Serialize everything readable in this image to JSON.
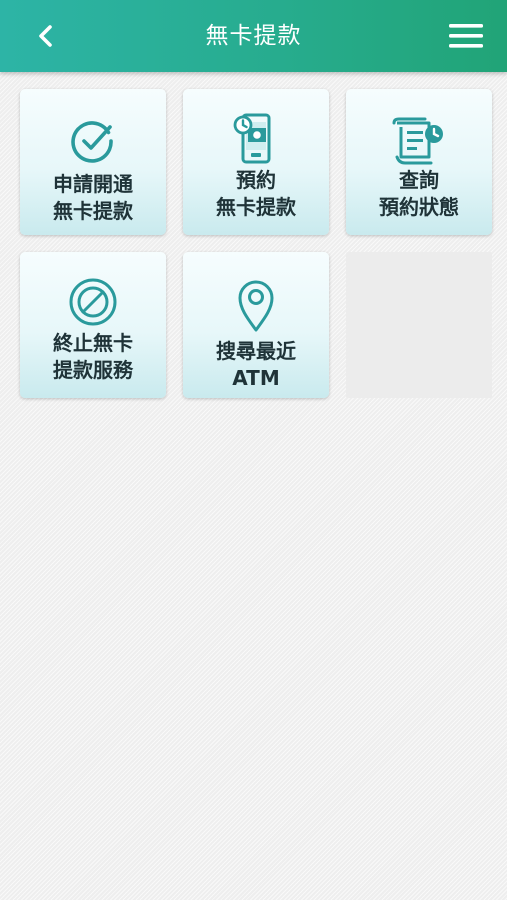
{
  "header": {
    "title": "無卡提款",
    "back_icon": "chevron-left-icon",
    "menu_icon": "hamburger-menu-icon"
  },
  "colors": {
    "header_start": "#2db4a6",
    "header_end": "#21a477",
    "icon_teal": "#2a9a9c",
    "label_text": "#1f3338"
  },
  "tiles": [
    {
      "line1": "申請開通",
      "line2": "無卡提款",
      "icon": "check-circle-icon"
    },
    {
      "line1": "預約",
      "line2": "無卡提款",
      "icon": "phone-cash-clock-icon"
    },
    {
      "line1": "查詢",
      "line2": "預約狀態",
      "icon": "receipt-clock-icon"
    },
    {
      "line1": "終止無卡",
      "line2": "提款服務",
      "icon": "prohibited-icon"
    },
    {
      "line1": "搜尋最近",
      "line2": "ATM",
      "icon": "location-pin-icon"
    }
  ]
}
